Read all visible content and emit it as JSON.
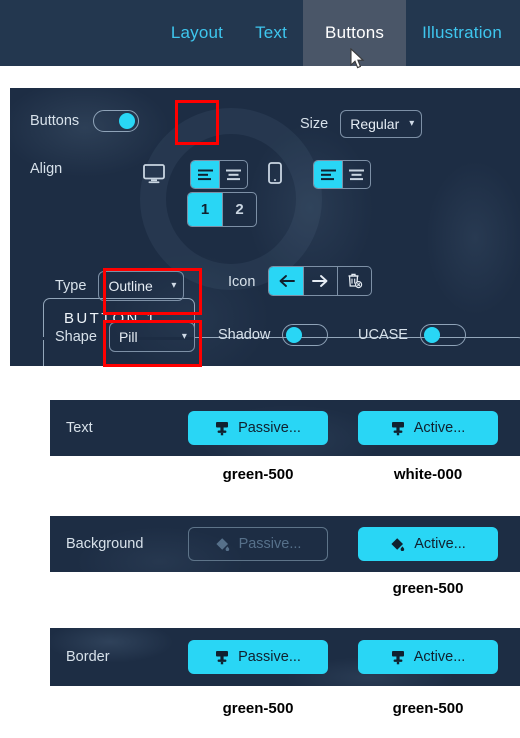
{
  "nav": {
    "tabs": [
      {
        "label": "Layout",
        "active": false
      },
      {
        "label": "Text",
        "active": false
      },
      {
        "label": "Buttons",
        "active": true
      },
      {
        "label": "Illustration",
        "active": false
      }
    ],
    "cursor_icon": "mouse-pointer-icon"
  },
  "controls": {
    "buttons_label": "Buttons",
    "buttons_toggle_state": "on",
    "count_tabs": [
      {
        "label": "1",
        "selected": true
      },
      {
        "label": "2",
        "selected": false
      }
    ],
    "size_label": "Size",
    "size_value": "Regular",
    "align_label": "Align",
    "desktop_icon": "monitor-icon",
    "mobile_icon": "mobile-phone-icon",
    "desktop_align": [
      {
        "icon": "align-left-icon",
        "selected": true
      },
      {
        "icon": "align-center-icon",
        "selected": false
      }
    ],
    "mobile_align": [
      {
        "icon": "align-left-icon",
        "selected": true
      },
      {
        "icon": "align-center-icon",
        "selected": false
      }
    ]
  },
  "button_card": {
    "tab_title": "BUTTON 1",
    "type_label": "Type",
    "type_value": "Outline",
    "icon_label": "Icon",
    "icon_options": [
      {
        "icon": "arrow-left-icon",
        "selected": true
      },
      {
        "icon": "arrow-right-icon",
        "selected": false
      },
      {
        "icon": "trash-remove-icon",
        "selected": false
      }
    ],
    "shape_label": "Shape",
    "shape_value": "Pill",
    "shadow_label": "Shadow",
    "shadow_toggle_state": "off",
    "ucase_label": "UCASE",
    "ucase_toggle_state": "off"
  },
  "color_rows": [
    {
      "label": "Text",
      "passive": {
        "text": "Passive...",
        "icon": "paint-brush-icon",
        "style": "filled",
        "caption": "green-500"
      },
      "active": {
        "text": "Active...",
        "icon": "paint-brush-icon",
        "style": "filled",
        "caption": "white-000"
      }
    },
    {
      "label": "Background",
      "passive": {
        "text": "Passive...",
        "icon": "paint-bucket-icon",
        "style": "ghost",
        "caption": ""
      },
      "active": {
        "text": "Active...",
        "icon": "paint-bucket-icon",
        "style": "filled",
        "caption": "green-500"
      }
    },
    {
      "label": "Border",
      "passive": {
        "text": "Passive...",
        "icon": "paint-brush-icon",
        "style": "filled",
        "caption": "green-500"
      },
      "active": {
        "text": "Active...",
        "icon": "paint-brush-icon",
        "style": "filled",
        "caption": "green-500"
      }
    }
  ],
  "colors": {
    "accent_cyan": "#29d6f5",
    "nav_background": "#23374f",
    "panel_background": "#1d2d44",
    "active_tab_background": "#4a5668",
    "nav_link": "#3ec6ee",
    "annotation_red": "#ff0000",
    "page_background": "#ffffff"
  },
  "annotations": {
    "highlight_count_tab": true,
    "highlight_type_select": true,
    "highlight_shape_select": true
  }
}
